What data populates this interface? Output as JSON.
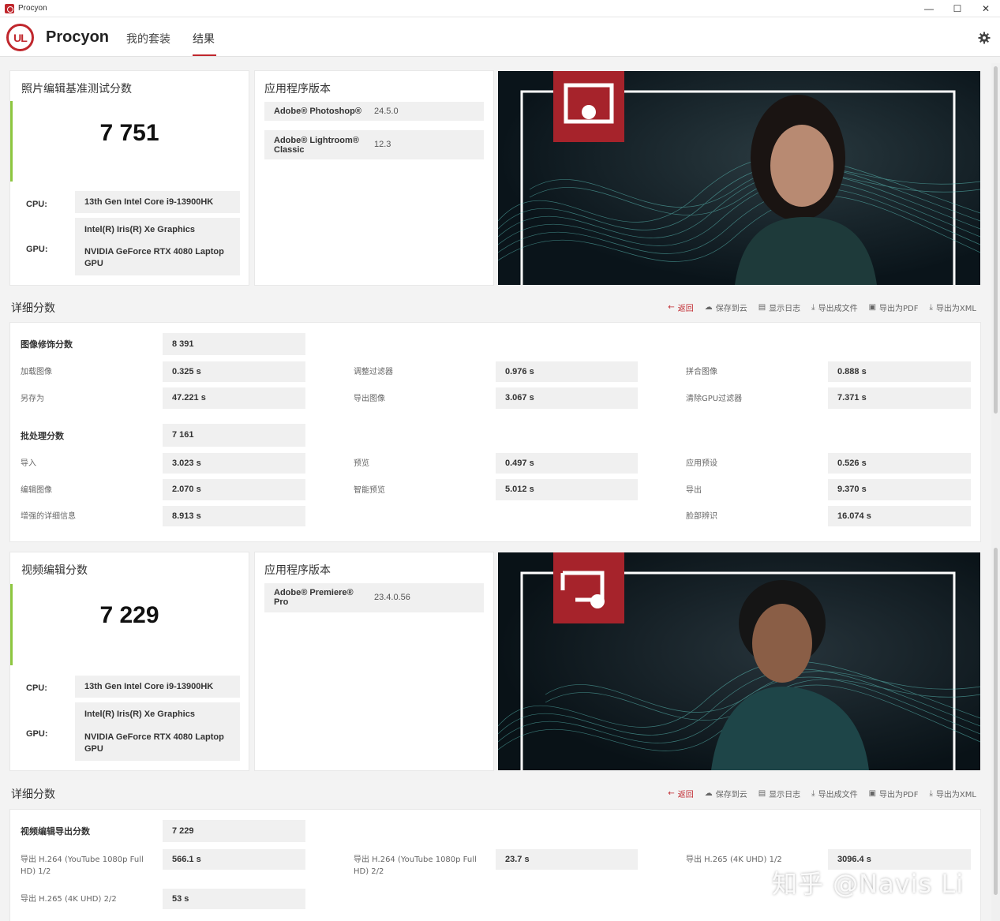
{
  "window": {
    "title": "Procyon",
    "controls": [
      "—",
      "☐",
      "✕"
    ]
  },
  "header": {
    "logo_text": "UL",
    "brand": "Procyon",
    "tabs": [
      {
        "label": "我的套装"
      },
      {
        "label": "结果",
        "active": true
      }
    ]
  },
  "photo": {
    "score_title": "照片编辑基准测试分数",
    "score": "7 751",
    "cpu_label": "CPU:",
    "cpu": "13th Gen Intel Core i9-13900HK",
    "gpu_label": "GPU:",
    "gpu1": "Intel(R) Iris(R) Xe Graphics",
    "gpu2": "NVIDIA GeForce RTX 4080 Laptop GPU",
    "apps_title": "应用程序版本",
    "apps": [
      {
        "name": "Adobe® Photoshop®",
        "version": "24.5.0"
      },
      {
        "name": "Adobe® Lightroom® Classic",
        "version": "12.3"
      }
    ],
    "detail_title": "详细分数",
    "retouch": {
      "label": "图像修饰分数",
      "value": "8 391",
      "rows": [
        [
          "加载图像",
          "0.325 s",
          "调整过滤器",
          "0.976 s",
          "拼合图像",
          "0.888 s"
        ],
        [
          "另存为",
          "47.221 s",
          "导出图像",
          "3.067 s",
          "清除GPU过滤器",
          "7.371 s"
        ]
      ]
    },
    "batch": {
      "label": "批处理分数",
      "value": "7 161",
      "rows": [
        [
          "导入",
          "3.023 s",
          "预览",
          "0.497 s",
          "应用预设",
          "0.526 s"
        ],
        [
          "编辑图像",
          "2.070 s",
          "智能预览",
          "5.012 s",
          "导出",
          "9.370 s"
        ],
        [
          "增强的详细信息",
          "8.913 s",
          "",
          "",
          "脸部辨识",
          "16.074 s"
        ]
      ]
    }
  },
  "video": {
    "score_title": "视频编辑分数",
    "score": "7 229",
    "cpu_label": "CPU:",
    "cpu": "13th Gen Intel Core i9-13900HK",
    "gpu_label": "GPU:",
    "gpu1": "Intel(R) Iris(R) Xe Graphics",
    "gpu2": "NVIDIA GeForce RTX 4080 Laptop GPU",
    "apps_title": "应用程序版本",
    "apps": [
      {
        "name": "Adobe® Premiere® Pro",
        "version": "23.4.0.56"
      }
    ],
    "detail_title": "详细分数",
    "export": {
      "label": "视频编辑导出分数",
      "value": "7 229",
      "rows": [
        [
          "导出 H.264 (YouTube 1080p Full HD) 1/2",
          "566.1 s",
          "导出 H.264 (YouTube 1080p Full HD) 2/2",
          "23.7 s",
          "导出 H.265 (4K UHD) 1/2",
          "3096.4 s"
        ],
        [
          "导出 H.265 (4K UHD) 2/2",
          "53 s",
          "",
          "",
          "",
          ""
        ]
      ]
    }
  },
  "actions": {
    "back": "返回",
    "save_cloud": "保存到云",
    "show_log": "显示日志",
    "export_file": "导出成文件",
    "export_pdf": "导出为PDF",
    "export_xml": "导出为XML"
  },
  "watermark": "知乎 @Navis Li",
  "colors": {
    "accent": "#c0272d",
    "score_bar": "#8dc63f",
    "wave": "#5fc8c0"
  }
}
